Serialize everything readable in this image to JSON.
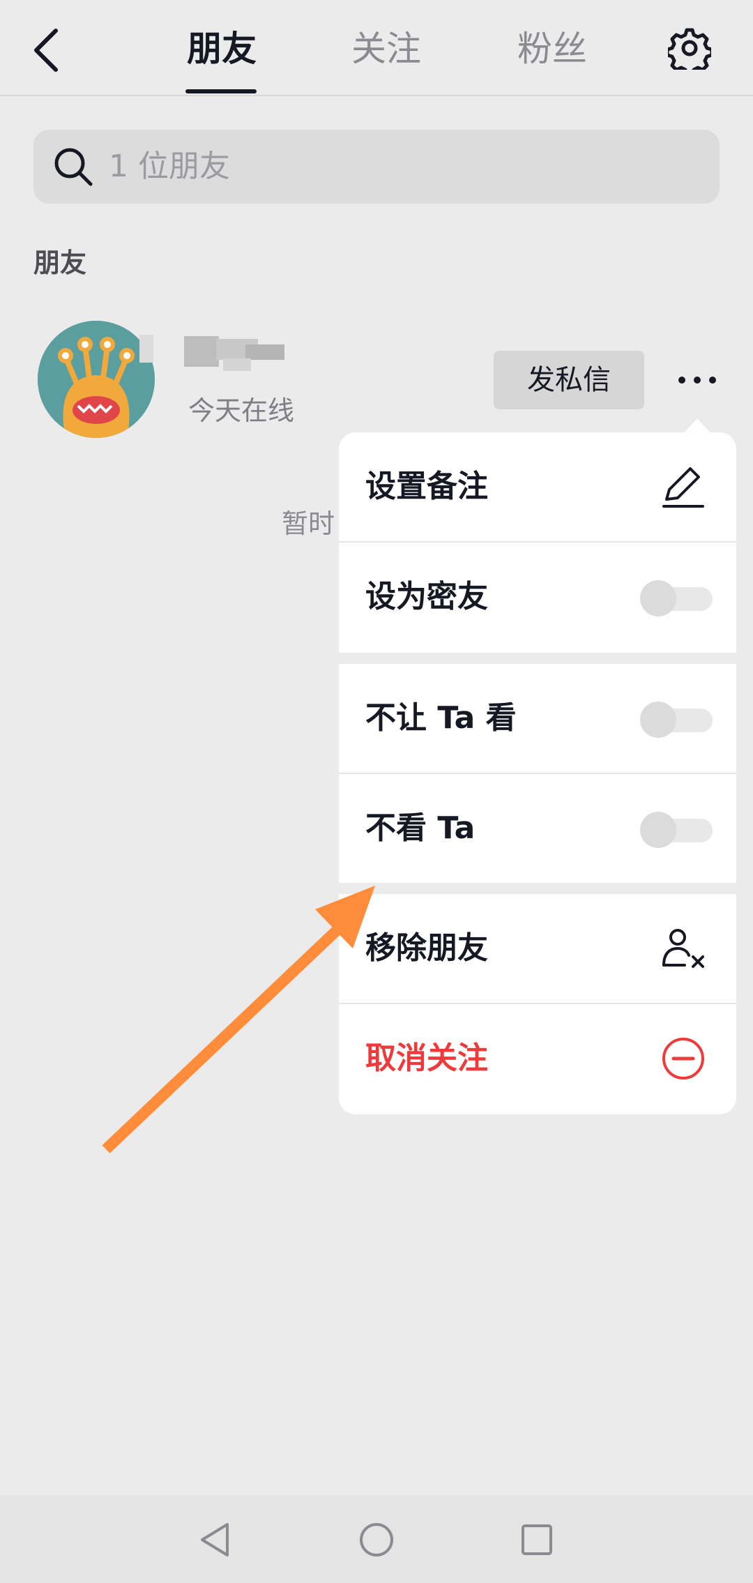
{
  "header": {
    "tabs": [
      {
        "label": "朋友",
        "active": true
      },
      {
        "label": "关注",
        "active": false
      },
      {
        "label": "粉丝",
        "active": false
      }
    ],
    "back_icon": "chevron-left-icon",
    "settings_icon": "gear-icon"
  },
  "search": {
    "placeholder": "1 位朋友",
    "icon": "search-icon"
  },
  "friends": {
    "section_title": "朋友",
    "items": [
      {
        "status": "今天在线",
        "dm_label": "发私信",
        "more_icon": "more-horizontal-icon"
      }
    ],
    "empty_text": "暂时"
  },
  "menu": {
    "items": [
      {
        "label": "设置备注",
        "control": "pencil-icon"
      },
      {
        "label": "设为密友",
        "control": "toggle",
        "on": false
      },
      {
        "label": "不让 Ta 看",
        "control": "toggle",
        "on": false
      },
      {
        "label": "不看 Ta",
        "control": "toggle",
        "on": false
      },
      {
        "label": "移除朋友",
        "control": "remove-user-icon"
      },
      {
        "label": "取消关注",
        "control": "minus-circle-icon",
        "color": "#ee3a3a"
      }
    ]
  },
  "colors": {
    "background": "#ebebeb",
    "primary_text": "#161823",
    "secondary_text": "#8a8b91",
    "danger": "#ee3a3a",
    "annotation_arrow": "#ff8c3a"
  },
  "navbar": {
    "icons": [
      "nav-back-icon",
      "nav-home-icon",
      "nav-recents-icon"
    ]
  }
}
